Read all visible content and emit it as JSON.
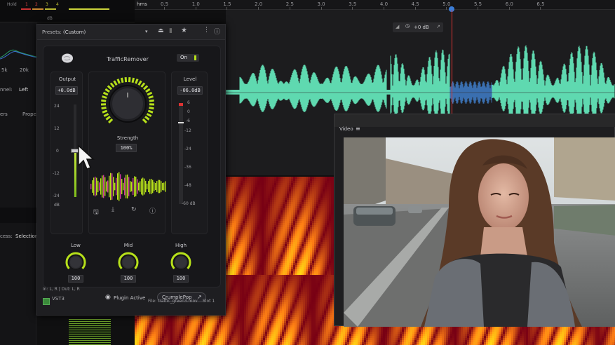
{
  "host": {
    "hold_label": "Hold",
    "meter_numbers": [
      "1",
      "2",
      "3",
      "4"
    ],
    "db_unit": "dB",
    "left_labels": {
      "freq_a": "5k",
      "freq_b": "20k",
      "channel": "nnel:",
      "channel_value": "Left",
      "ers": "ers",
      "props": "Prope",
      "cess": "cess:",
      "selection": "Selection"
    },
    "ruler_unit": "hms",
    "ruler_ticks": [
      "0.5",
      "1.0",
      "1.5",
      "2.0",
      "2.5",
      "3.0",
      "3.5",
      "4.0",
      "4.5",
      "5.0",
      "5.5",
      "6.0",
      "6.5"
    ],
    "tool_pill_label": "+0 dB"
  },
  "plugin": {
    "presets_label": "Presets:",
    "preset_value": "(Custom)",
    "title": "TrafficRemover",
    "power_label": "On",
    "output": {
      "title": "Output",
      "value": "+0.0dB",
      "scale": [
        "24",
        "12",
        "0",
        "-12",
        "-24"
      ],
      "unit": "dB",
      "fader_level": 0.5
    },
    "strength": {
      "label": "Strength",
      "value": "100%"
    },
    "level": {
      "title": "Level",
      "value": "-06.0dB",
      "scale": [
        "6",
        "0",
        "-6",
        "-12",
        "-24",
        "-36",
        "-48",
        "-60 dB"
      ]
    },
    "eq": [
      {
        "label": "Low",
        "value": "100"
      },
      {
        "label": "Mid",
        "value": "100"
      },
      {
        "label": "High",
        "value": "100"
      }
    ],
    "vst_label": "VST3",
    "plugin_active_label": "Plugin Active",
    "brand_button": "CrumplePop",
    "footer": {
      "io": "In: L, R | Out: L, R",
      "file": "File: traffic_green3.mov",
      "slot": "Slot 1"
    }
  },
  "video": {
    "title": "Video"
  },
  "colors": {
    "accent": "#b7e11a",
    "waveform": "#5fd9b0",
    "playhead": "#dd3333"
  }
}
